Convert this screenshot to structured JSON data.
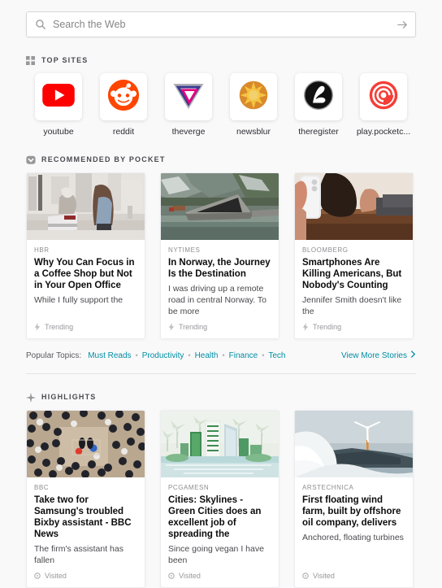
{
  "search": {
    "placeholder": "Search the Web",
    "value": "",
    "icon": "search-icon",
    "submit_icon": "arrow-right-icon"
  },
  "top_sites": {
    "heading": "TOP SITES",
    "heading_icon": "grid-icon",
    "items": [
      {
        "label": "youtube",
        "icon": "youtube-logo"
      },
      {
        "label": "reddit",
        "icon": "reddit-logo"
      },
      {
        "label": "theverge",
        "icon": "theverge-logo"
      },
      {
        "label": "newsblur",
        "icon": "newsblur-logo"
      },
      {
        "label": "theregister",
        "icon": "theregister-logo"
      },
      {
        "label": "play.pocketc...",
        "icon": "pocketcasts-logo"
      }
    ]
  },
  "pocket": {
    "heading": "RECOMMENDED BY POCKET",
    "heading_icon": "pocket-icon",
    "cards": [
      {
        "domain": "HBR",
        "title": "Why You Can Focus in a Coffee Shop but Not in Your Open Office",
        "excerpt": "While I fully support the",
        "status": "Trending",
        "status_icon": "lightning-icon",
        "image": "coffee-shop-workers-photo"
      },
      {
        "domain": "NYTIMES",
        "title": "In Norway, the Journey Is the Destination",
        "excerpt": "I was driving up a remote road in central Norway. To be more",
        "status": "Trending",
        "status_icon": "lightning-icon",
        "image": "norway-fjord-architecture-photo"
      },
      {
        "domain": "BLOOMBERG",
        "title": "Smartphones Are Killing Americans, But Nobody's Counting",
        "excerpt": "Jennifer Smith doesn't like the",
        "status": "Trending",
        "status_icon": "lightning-icon",
        "image": "child-smartphone-table-photo"
      }
    ],
    "topics_label": "Popular Topics:",
    "topics": [
      "Must Reads",
      "Productivity",
      "Health",
      "Finance",
      "Tech"
    ],
    "more_stories": "View More Stories",
    "more_stories_icon": "chevron-right-icon"
  },
  "highlights": {
    "heading": "HIGHLIGHTS",
    "heading_icon": "sparkle-icon",
    "cards": [
      {
        "domain": "BBC",
        "title": "Take two for Samsung's troubled Bixby assistant - BBC News",
        "excerpt": "The firm's assistant has fallen",
        "status": "Visited",
        "status_icon": "history-icon",
        "image": "crowd-overhead-photo"
      },
      {
        "domain": "PCGAMESN",
        "title": "Cities: Skylines - Green Cities does an excellent job of spreading the",
        "excerpt": "Since going vegan I have been",
        "status": "Visited",
        "status_icon": "history-icon",
        "image": "green-city-skyline-art"
      },
      {
        "domain": "ARSTECHNICA",
        "title": "First floating wind farm, built by offshore oil company, delivers",
        "excerpt": "Anchored, floating turbines",
        "status": "Visited",
        "status_icon": "history-icon",
        "image": "offshore-wind-turbine-photo"
      }
    ]
  },
  "colors": {
    "background": "#f9f9fa",
    "link": "#008ea4",
    "card_background": "#ffffff",
    "text": "#0c0c0d",
    "muted_text": "#8e8e93"
  }
}
